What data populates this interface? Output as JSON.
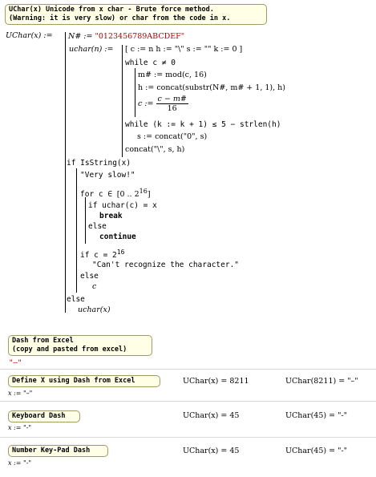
{
  "note_title_line1": "UChar(x) Unicode from x char - Brute force method.",
  "note_title_line2": "(Warning: it is very slow) or char from the code in x.",
  "def_lhs": "UChar(x) :=",
  "nsharp_assign": "N# := ",
  "nsharp_value": "\"0123456789ABCDEF\"",
  "uchar_def": "uchar(n) :=",
  "init_line": "[ c := n   h := \"\\\"   s := \"\"   k := 0 ]",
  "while1": "while  c ≠ 0",
  "m_assign": "m# := mod(c, 16)",
  "h_assign": "h := concat(substr(N#, m# + 1, 1), h)",
  "c_assign_lhs": "c :=",
  "c_num": "c − m#",
  "c_den": "16",
  "while2": "while  (k := k + 1) ≤ 5 − strlen(h)",
  "s_assign": "s := concat(\"0\", s)",
  "ret_concat": "concat(\"\\\", s, h)",
  "if_isstring": "if  IsString(x)",
  "very_slow": "\"Very slow!\"",
  "for_line_pre": "for  c ∈ ",
  "for_range": "[0 .. 2",
  "for_exp": "16",
  "for_close": "]",
  "if_uchar": "if  uchar(c) = x",
  "break_kw": "break",
  "else1": "else",
  "continue_kw": "continue",
  "if_c_eq": "if  c = 2",
  "if_c_exp": "16",
  "cant_recognize": "\"Can't recognize the character.\"",
  "else2": "else",
  "c_ret": "c",
  "else3": "else",
  "uchar_x": "uchar(x)",
  "note_dash_line1": "Dash from Excel",
  "note_dash_line2": "(copy and pasted from excel)",
  "dash_value": "\"–\"",
  "note_define_x": "Define X using Dash from Excel",
  "r1_x_assign": "x := \"–\"",
  "r1_eval1": "UChar(x) = 8211",
  "r1_eval2": "UChar(8211) = \"–\"",
  "note_keyboard": "Keyboard Dash",
  "r2_x_assign": "x := \"-\"",
  "r2_eval1": "UChar(x) = 45",
  "r2_eval2": "UChar(45) = \"-\"",
  "note_keypad": "Number Key-Pad Dash",
  "r3_x_assign": "x := \"-\"",
  "r3_eval1": "UChar(x) = 45",
  "r3_eval2": "UChar(45) = \"-\""
}
